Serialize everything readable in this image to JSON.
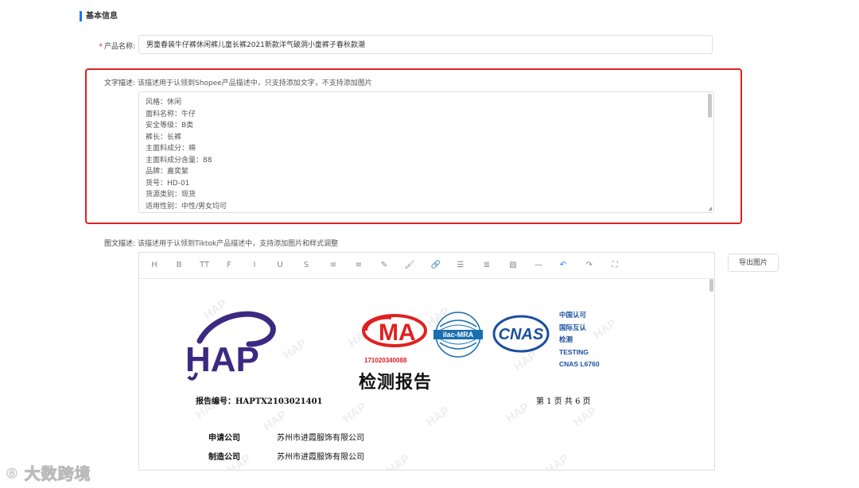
{
  "section": {
    "title": "基本信息"
  },
  "product_name": {
    "required_mark": "*",
    "label": "产品名称:",
    "value": "男童春装牛仔裤休闲裤儿童长裤2021新款洋气破洞小童裤子春秋款潮"
  },
  "text_description": {
    "label": "文字描述:",
    "hint": "该描述用于认领到Shopee产品描述中，只支持添加文字，不支持添加图片",
    "lines": [
      "风格：休闲",
      "面料名称：牛仔",
      "安全等级：B类",
      "裤长：长裤",
      "主面料成分：棉",
      "主面料成分含量：88",
      "品牌：嘉奕絮",
      "货号：HD-01",
      "货源类别：现货",
      "适用性别：中性/男女均可"
    ]
  },
  "rich_description": {
    "label": "图文描述:",
    "hint": "该描述用于认领到Tiktok产品描述中，支持添加图片和样式调整",
    "toolbar": [
      {
        "icon": "heading-icon",
        "glyph": "H"
      },
      {
        "icon": "bold-icon",
        "glyph": "B"
      },
      {
        "icon": "font-size-icon",
        "glyph": "TT"
      },
      {
        "icon": "font-family-icon",
        "glyph": "F"
      },
      {
        "icon": "italic-icon",
        "glyph": "I"
      },
      {
        "icon": "underline-icon",
        "glyph": "U"
      },
      {
        "icon": "strikethrough-icon",
        "glyph": "S"
      },
      {
        "icon": "indent-icon",
        "glyph": "≡"
      },
      {
        "icon": "line-height-icon",
        "glyph": "≡"
      },
      {
        "icon": "font-color-icon",
        "glyph": "✎"
      },
      {
        "icon": "background-color-icon",
        "glyph": "🖌"
      },
      {
        "icon": "link-icon",
        "glyph": "🔗"
      },
      {
        "icon": "list-icon",
        "glyph": "☰"
      },
      {
        "icon": "align-icon",
        "glyph": "≣"
      },
      {
        "icon": "image-icon",
        "glyph": "▨"
      },
      {
        "icon": "divider-icon",
        "glyph": "—"
      },
      {
        "icon": "undo-icon",
        "glyph": "↶"
      },
      {
        "icon": "redo-icon",
        "glyph": "↷"
      },
      {
        "icon": "fullscreen-icon",
        "glyph": "⛶"
      }
    ],
    "export_button": "导出图片"
  },
  "document": {
    "logo_text": "HAP",
    "cma_text": "MA",
    "cma_number": "171020340088",
    "ilac_text": "ilac-MRA",
    "cnas_text": "CNAS",
    "cert_lines": [
      "中国认可",
      "国际互认",
      "检测",
      "TESTING",
      "CNAS L6760"
    ],
    "title": "检测报告",
    "report_number": "报告编号：HAPTX2103021401",
    "page_info": "第 1 页 共 6 页",
    "applicant_label": "申请公司",
    "applicant_value": "苏州市进霞服饰有限公司",
    "manufacturer_label": "制造公司",
    "manufacturer_value": "苏州市进霞服饰有限公司",
    "watermark": "HAP"
  },
  "brand_watermark": "大数跨境",
  "colors": {
    "accent": "#1677ff",
    "highlight_border": "#e02020",
    "cma_red": "#e02020",
    "cnas_blue": "#1a4f9c",
    "hap_purple": "#3b2a82"
  }
}
